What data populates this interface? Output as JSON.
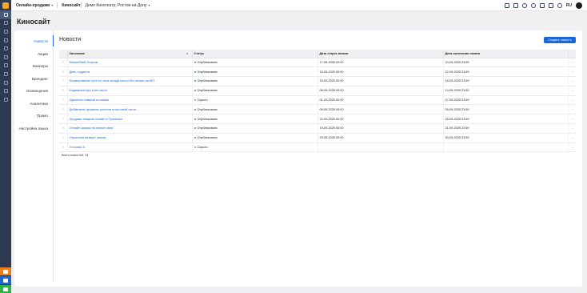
{
  "topbar": {
    "online_sales": "Онлайн-продажи",
    "site": "Киносайт",
    "cinema": "Демо Кинотеатр, Ростов-на-Дону",
    "lang": "RU"
  },
  "page": {
    "title": "Киносайт"
  },
  "sidebar": {
    "items": [
      {
        "label": "Новости",
        "active": true
      },
      {
        "label": "Акции"
      },
      {
        "label": "Баннеры"
      },
      {
        "label": "Брендинг"
      },
      {
        "label": "Оповещения"
      },
      {
        "label": "Аналитика"
      },
      {
        "label": "Промо"
      },
      {
        "label": "Настройка языка"
      }
    ]
  },
  "content": {
    "heading": "Новости",
    "create_button": "Создать новость",
    "columns": [
      "Заголовок",
      "Статус",
      "Дата старта показа",
      "Дата окончания показа"
    ],
    "rows": [
      {
        "title": "Волшебный Егорчик",
        "status": "Опубликовано",
        "start": "17-09-2025 00:00",
        "end": "24-09-2025 23:59"
      },
      {
        "title": "День студента",
        "status": "Опубликовано",
        "start": "15-09-2025 00:00",
        "end": "22-09-2025 23:59"
      },
      {
        "title": "Формирование пустого чека захода кассы без печати на ККТ",
        "status": "Опубликовано",
        "start": "15-09-2025 00:00",
        "end": "18-09-2025 23:59"
      },
      {
        "title": "Модификаторы в ген кассе",
        "status": "Опубликовано",
        "start": "08-09-2025 00:00",
        "end": "14-09-2025 23:59"
      },
      {
        "title": "Удаление товаров из заказа",
        "status": "Скрыто",
        "start": "01-09-2025 00:00",
        "end": "07-09-2025 23:59"
      },
      {
        "title": "Добавлены форматы репетов в кассовой части",
        "status": "Опубликовано",
        "start": "09-09-2025 00:00",
        "end": "09-09-2025 23:59"
      },
      {
        "title": "Продажа товаров онлайн в Премьере",
        "status": "Опубликовано",
        "start": "22-09-2025 00:00",
        "end": "25-09-2025 23:59"
      },
      {
        "title": "Онлайн заказы на сеансе зала",
        "status": "Опубликовано",
        "start": "19-09-2025 00:00",
        "end": "21-09-2025 23:59"
      },
      {
        "title": "Упростили возврат заказа",
        "status": "Опубликовано",
        "start": "29-09-2025 00:00",
        "end": "30-09-2025 23:59"
      },
      {
        "title": "Тестовая 3",
        "status": "Скрыто",
        "start": "",
        "end": ""
      }
    ],
    "total": "Всего новостей: 14"
  },
  "colors": {
    "accent": "#1a67d8",
    "published": "#2fb344",
    "hidden": "#9aa0aa",
    "rail": "#2e3a52",
    "logo": "#f5a524"
  },
  "icons": [
    "app-logo-icon",
    "grid-icon",
    "cart-icon",
    "user-icon",
    "chart-icon",
    "star-icon",
    "film-icon",
    "ticket-icon",
    "tag-icon",
    "calendar-icon",
    "settings-icon",
    "chat-icon",
    "phone-icon",
    "bell-icon",
    "help-icon"
  ]
}
